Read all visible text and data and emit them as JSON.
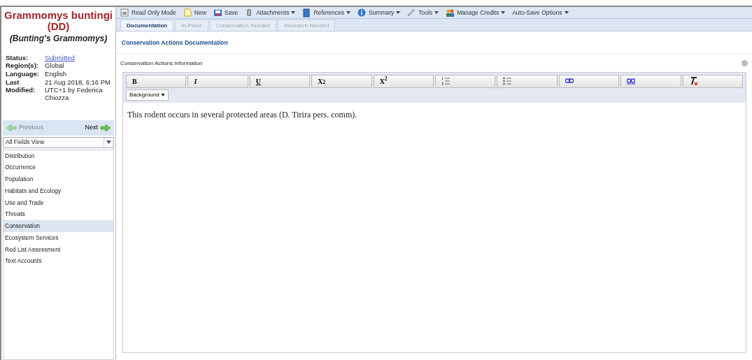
{
  "species": {
    "name": "Grammomys buntingi",
    "category": "(DD)",
    "common_name": "(Bunting's Grammomys)"
  },
  "details": [
    {
      "label": "Status:",
      "value": "Submitted",
      "kind": "link"
    },
    {
      "label": "Region(s):",
      "value": "Global",
      "kind": "text"
    },
    {
      "label": "Language:",
      "value": "English",
      "kind": "text"
    },
    {
      "label": "Last Modified:",
      "value": "21 Aug 2018, 6:16 PM UTC+1 by Federica Chiozza",
      "kind": "text"
    }
  ],
  "pager": {
    "previous": {
      "label": "Previous",
      "disabled": true
    },
    "next": {
      "label": "Next",
      "disabled": false
    }
  },
  "view_select": {
    "value": "All Fields View"
  },
  "sections": [
    {
      "label": "Distribution",
      "selected": false
    },
    {
      "label": "Occurrence",
      "selected": false
    },
    {
      "label": "Population",
      "selected": false
    },
    {
      "label": "Habitats and Ecology",
      "selected": false
    },
    {
      "label": "Use and Trade",
      "selected": false
    },
    {
      "label": "Threats",
      "selected": false
    },
    {
      "label": "Conservation",
      "selected": true
    },
    {
      "label": "Ecosystem Services",
      "selected": false
    },
    {
      "label": "Red List Assessment",
      "selected": false
    },
    {
      "label": "Text Accounts",
      "selected": false
    }
  ],
  "toolbar": [
    {
      "kind": "readonly",
      "label": "Read Only Mode",
      "dropdown": false
    },
    {
      "kind": "new",
      "label": "New",
      "dropdown": false
    },
    {
      "kind": "save",
      "label": "Save",
      "dropdown": false
    },
    {
      "kind": "attach",
      "label": "Attachments",
      "dropdown": true
    },
    {
      "kind": "book",
      "label": "References",
      "dropdown": true
    },
    {
      "kind": "info",
      "label": "Summary",
      "dropdown": true
    },
    {
      "kind": "wrench",
      "label": "Tools",
      "dropdown": true
    },
    {
      "kind": "people",
      "label": "Manage Credits",
      "dropdown": true
    },
    {
      "kind": "none",
      "label": "Auto-Save Options",
      "dropdown": true
    }
  ],
  "tabs": [
    {
      "label": "Documentation",
      "selected": true
    },
    {
      "label": "In-Place",
      "selected": false
    },
    {
      "label": "Conservation Needed",
      "selected": false
    },
    {
      "label": "Research Needed",
      "selected": false
    }
  ],
  "page_title": "Conservation Actions Documentation",
  "field_label": "Conservation Actions Information",
  "editor": {
    "buttons": [
      {
        "kind": "text",
        "label": "B"
      },
      {
        "kind": "text",
        "label": "I"
      },
      {
        "kind": "text",
        "label": "U"
      },
      {
        "kind": "text",
        "label": "X$_{2}$"
      },
      {
        "kind": "text",
        "label": "X$^{2}$"
      },
      {
        "kind": "ordered"
      },
      {
        "kind": "bullets"
      },
      {
        "kind": "link"
      },
      {
        "kind": "unlink"
      },
      {
        "kind": "clear"
      }
    ],
    "background_label": "Background",
    "content": "This rodent occurs in several protected areas (D. Tirira pers. comm)."
  }
}
